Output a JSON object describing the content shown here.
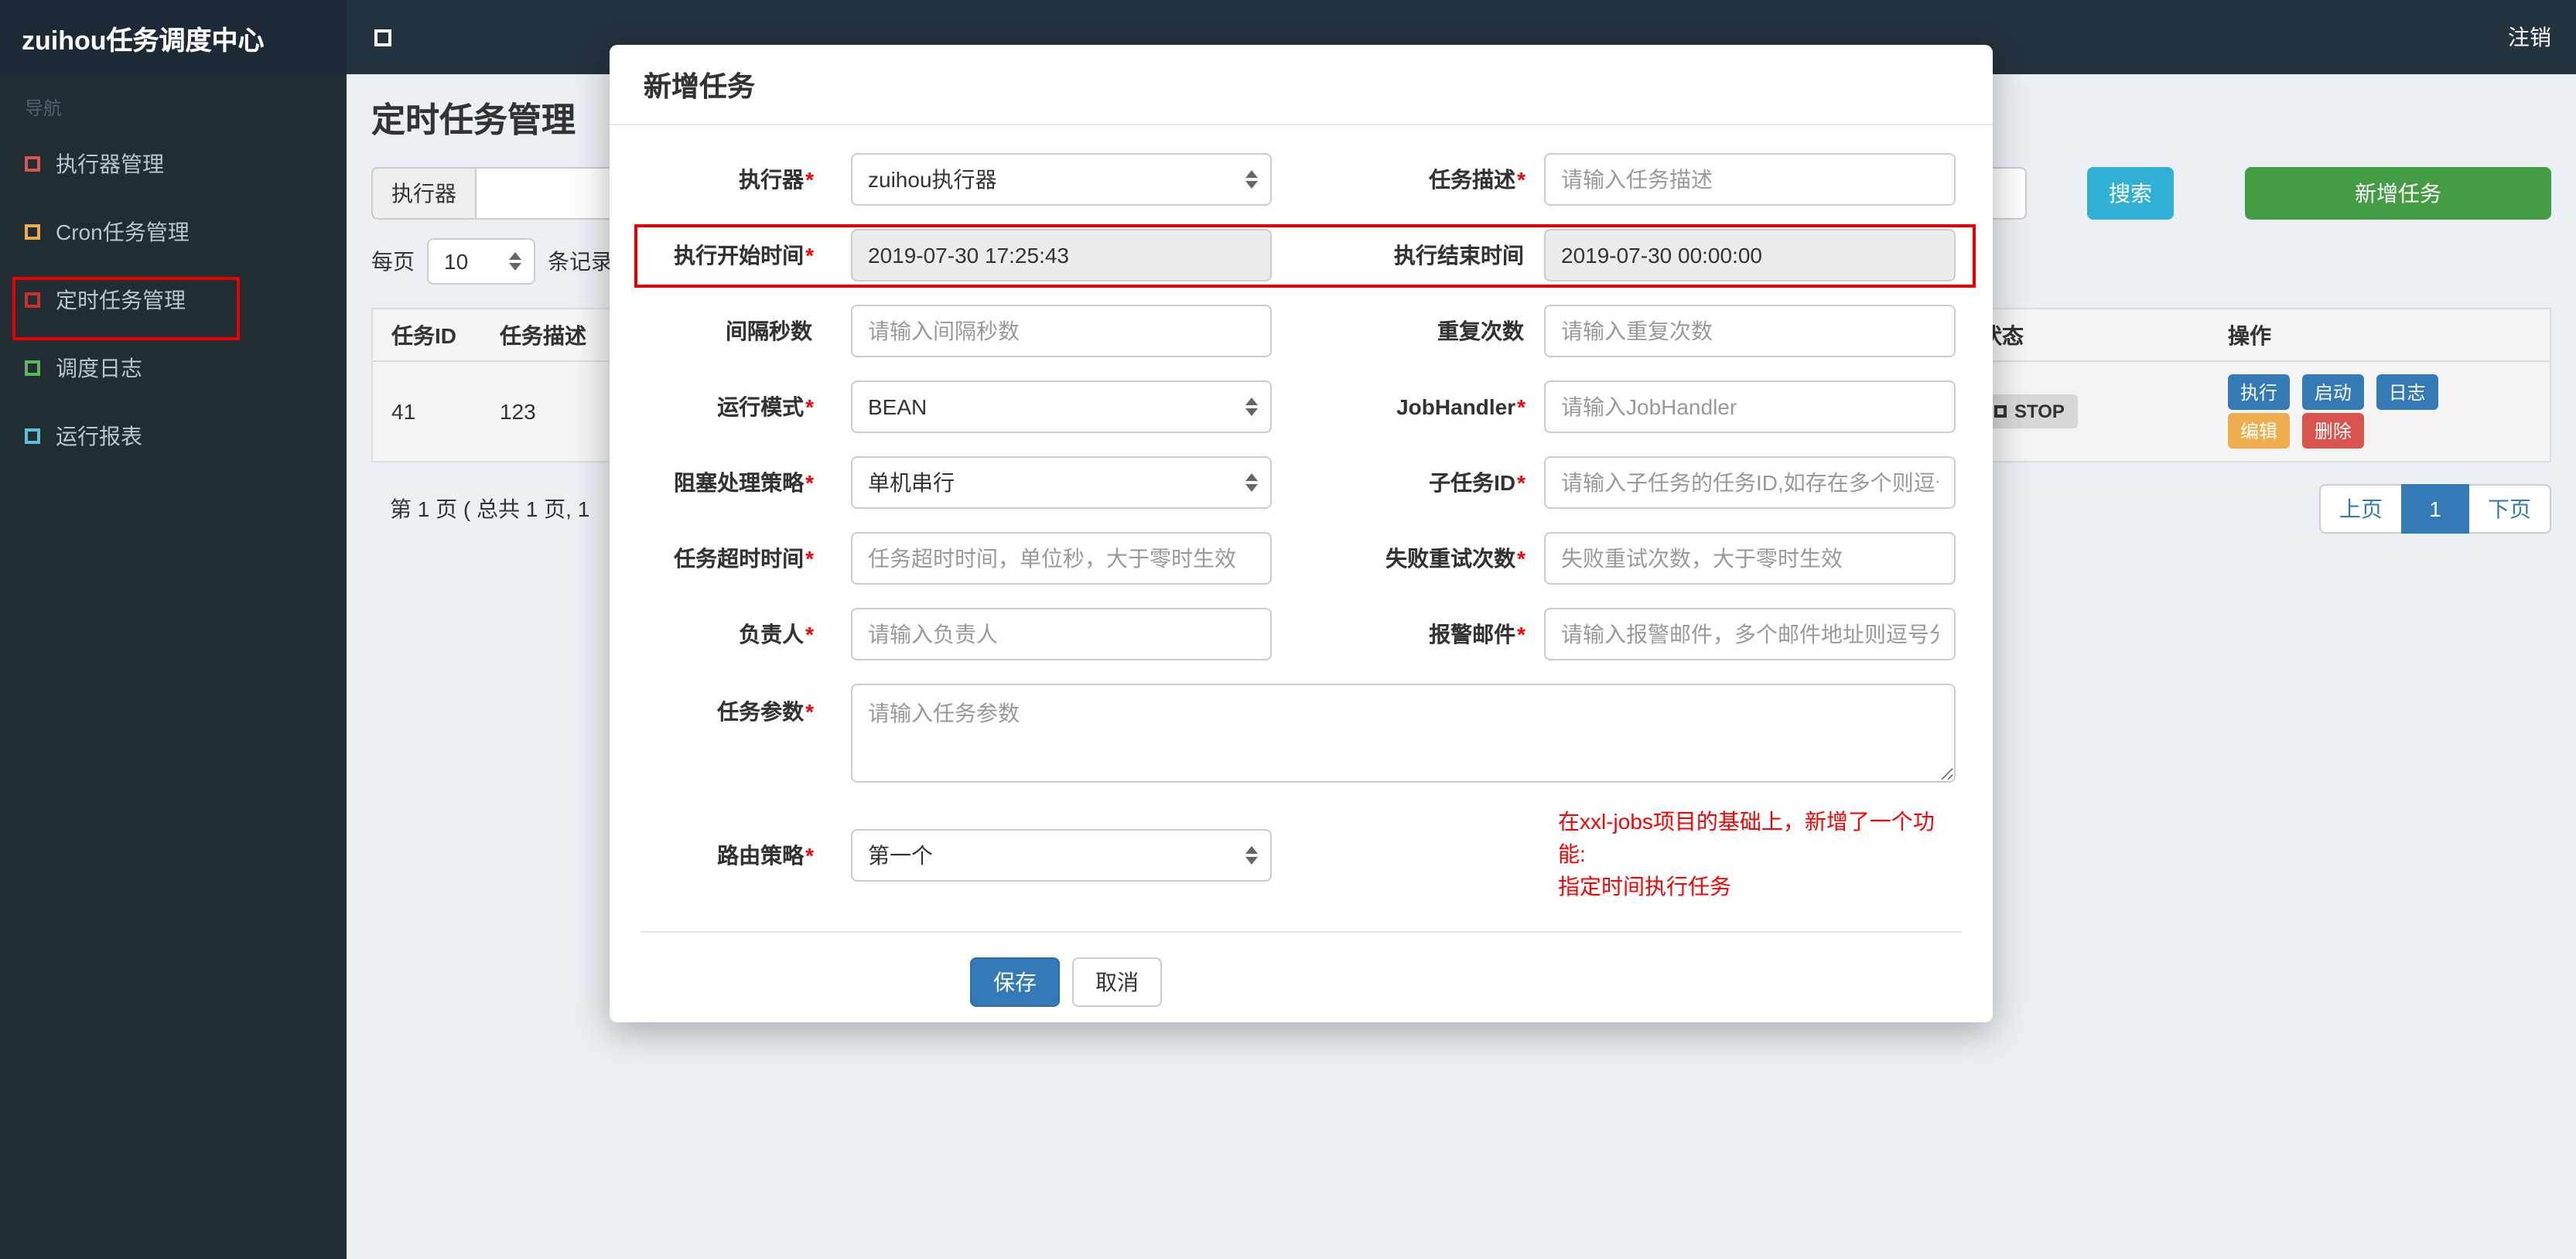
{
  "colors": {
    "navbar_bg": "#24323e",
    "brand_bg": "#1d2a35",
    "sidebar_bg": "#222d32",
    "content_bg": "#ecf0f5",
    "search_button": "#31b0d5",
    "add_button": "#449d44",
    "primary_button": "#337ab7",
    "edit_button": "#f0ad4e",
    "delete_button": "#d9534f",
    "annotation_red": "#e60000"
  },
  "navbar": {
    "brand": "zuihou任务调度中心",
    "logout": "注销"
  },
  "sidebar": {
    "section": "导航",
    "items": [
      {
        "label": "执行器管理"
      },
      {
        "label": "Cron任务管理"
      },
      {
        "label": "定时任务管理"
      },
      {
        "label": "调度日志"
      },
      {
        "label": "运行报表"
      }
    ]
  },
  "page": {
    "title": "定时任务管理",
    "filter": {
      "executor_label": "执行器",
      "search": "搜索",
      "add": "新增任务"
    },
    "per_page": {
      "label": "每页",
      "value": "10",
      "suffix": "条记录"
    },
    "table": {
      "headers": {
        "id": "任务ID",
        "desc": "任务描述",
        "status": "状态",
        "actions": "操作"
      },
      "row": {
        "id": "41",
        "desc": "123",
        "status": "STOP",
        "actions": {
          "run": "执行",
          "start": "启动",
          "log": "日志",
          "edit": "编辑",
          "del": "删除"
        }
      }
    },
    "pagination": {
      "summary": "第 1 页 ( 总共 1 页, 1",
      "prev": "上页",
      "current": "1",
      "next": "下页"
    }
  },
  "modal": {
    "title": "新增任务",
    "fields": {
      "executor": {
        "label": "执行器",
        "required": "*",
        "value": "zuihou执行器"
      },
      "desc": {
        "label": "任务描述",
        "required": "*",
        "placeholder": "请输入任务描述"
      },
      "start_time": {
        "label": "执行开始时间",
        "required": "*",
        "value": "2019-07-30 17:25:43"
      },
      "end_time": {
        "label": "执行结束时间",
        "value": "2019-07-30 00:00:00"
      },
      "interval": {
        "label": "间隔秒数",
        "placeholder": "请输入间隔秒数"
      },
      "repeat": {
        "label": "重复次数",
        "placeholder": "请输入重复次数"
      },
      "run_mode": {
        "label": "运行模式",
        "required": "*",
        "value": "BEAN"
      },
      "job_handler": {
        "label": "JobHandler",
        "required": "*",
        "placeholder": "请输入JobHandler"
      },
      "block_strategy": {
        "label": "阻塞处理策略",
        "required": "*",
        "value": "单机串行"
      },
      "child_job": {
        "label": "子任务ID",
        "required": "*",
        "placeholder": "请输入子任务的任务ID,如存在多个则逗号分隔"
      },
      "timeout": {
        "label": "任务超时时间",
        "required": "*",
        "placeholder": "任务超时时间，单位秒，大于零时生效"
      },
      "retry": {
        "label": "失败重试次数",
        "required": "*",
        "placeholder": "失败重试次数，大于零时生效"
      },
      "owner": {
        "label": "负责人",
        "required": "*",
        "placeholder": "请输入负责人"
      },
      "alarm_email": {
        "label": "报警邮件",
        "required": "*",
        "placeholder": "请输入报警邮件，多个邮件地址则逗号分隔"
      },
      "params": {
        "label": "任务参数",
        "required": "*",
        "placeholder": "请输入任务参数"
      },
      "route_strategy": {
        "label": "路由策略",
        "required": "*",
        "value": "第一个"
      }
    },
    "note_line1": "在xxl-jobs项目的基础上，新增了一个功能:",
    "note_line2": "指定时间执行任务",
    "save": "保存",
    "cancel": "取消"
  }
}
